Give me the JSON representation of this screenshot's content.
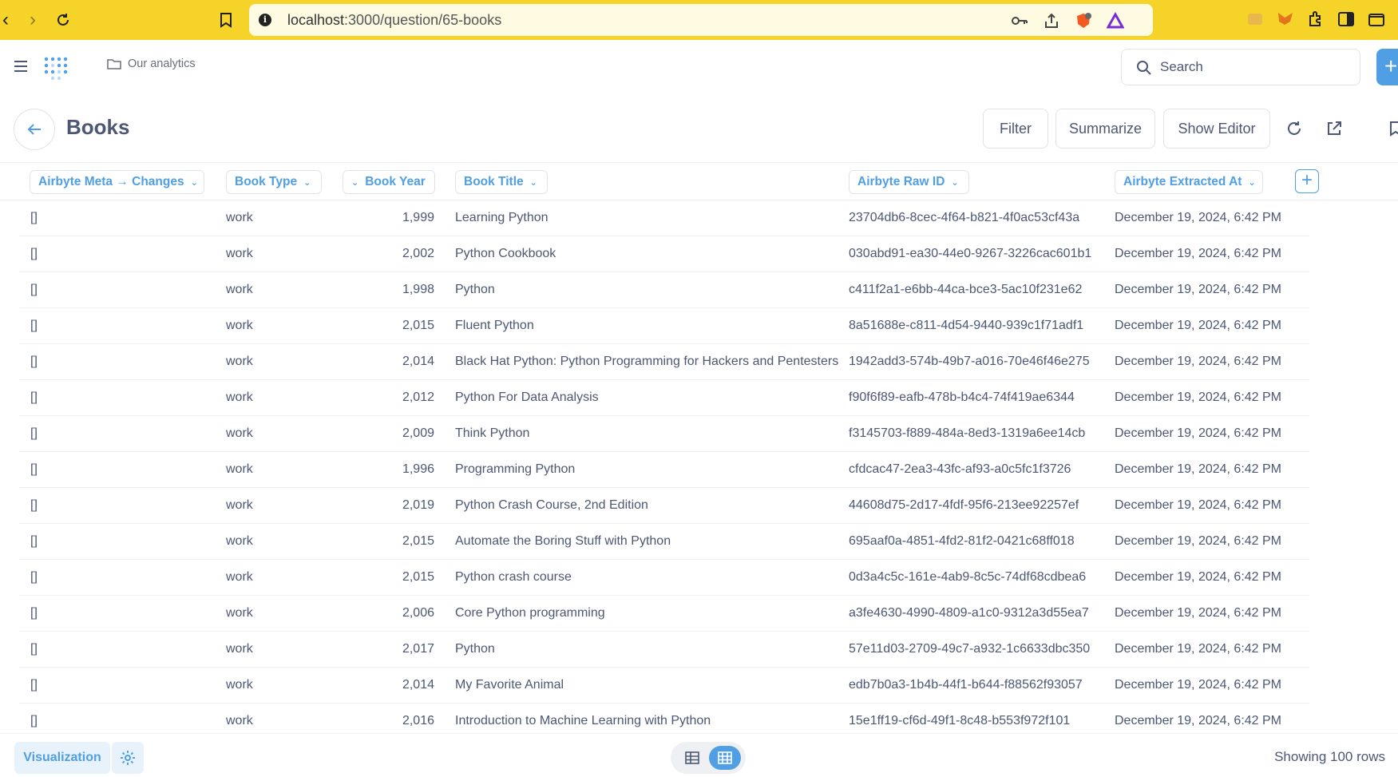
{
  "browser": {
    "url_host": "localhost",
    "url_path": ":3000/question/65-books"
  },
  "header": {
    "breadcrumb": "Our analytics",
    "search_placeholder": "Search",
    "new_label": "+"
  },
  "title_row": {
    "title": "Books",
    "filter_label": "Filter",
    "summarize_label": "Summarize",
    "show_editor_label": "Show Editor"
  },
  "columns": [
    {
      "label": "Airbyte Meta → Changes"
    },
    {
      "label": "Book Type"
    },
    {
      "label": "Book Year"
    },
    {
      "label": "Book Title"
    },
    {
      "label": "Airbyte Raw ID"
    },
    {
      "label": "Airbyte Extracted At"
    }
  ],
  "rows": [
    {
      "meta": "[]",
      "type": "work",
      "year": "1,999",
      "title": "Learning Python",
      "raw_id": "23704db6-8cec-4f64-b821-4f0ac53cf43a",
      "extracted": "December 19, 2024, 6:42 PM"
    },
    {
      "meta": "[]",
      "type": "work",
      "year": "2,002",
      "title": "Python Cookbook",
      "raw_id": "030abd91-ea30-44e0-9267-3226cac601b1",
      "extracted": "December 19, 2024, 6:42 PM"
    },
    {
      "meta": "[]",
      "type": "work",
      "year": "1,998",
      "title": "Python",
      "raw_id": "c411f2a1-e6bb-44ca-bce3-5ac10f231e62",
      "extracted": "December 19, 2024, 6:42 PM"
    },
    {
      "meta": "[]",
      "type": "work",
      "year": "2,015",
      "title": "Fluent Python",
      "raw_id": "8a51688e-c811-4d54-9440-939c1f71adf1",
      "extracted": "December 19, 2024, 6:42 PM"
    },
    {
      "meta": "[]",
      "type": "work",
      "year": "2,014",
      "title": "Black Hat Python: Python Programming for Hackers and Pentesters",
      "raw_id": "1942add3-574b-49b7-a016-70e46f46e275",
      "extracted": "December 19, 2024, 6:42 PM"
    },
    {
      "meta": "[]",
      "type": "work",
      "year": "2,012",
      "title": "Python For Data Analysis",
      "raw_id": "f90f6f89-eafb-478b-b4c4-74f419ae6344",
      "extracted": "December 19, 2024, 6:42 PM"
    },
    {
      "meta": "[]",
      "type": "work",
      "year": "2,009",
      "title": "Think Python",
      "raw_id": "f3145703-f889-484a-8ed3-1319a6ee14cb",
      "extracted": "December 19, 2024, 6:42 PM"
    },
    {
      "meta": "[]",
      "type": "work",
      "year": "1,996",
      "title": "Programming Python",
      "raw_id": "cfdcac47-2ea3-43fc-af93-a0c5fc1f3726",
      "extracted": "December 19, 2024, 6:42 PM"
    },
    {
      "meta": "[]",
      "type": "work",
      "year": "2,019",
      "title": "Python Crash Course, 2nd Edition",
      "raw_id": "44608d75-2d17-4fdf-95f6-213ee92257ef",
      "extracted": "December 19, 2024, 6:42 PM"
    },
    {
      "meta": "[]",
      "type": "work",
      "year": "2,015",
      "title": "Automate the Boring Stuff with Python",
      "raw_id": "695aaf0a-4851-4fd2-81f2-0421c68ff018",
      "extracted": "December 19, 2024, 6:42 PM"
    },
    {
      "meta": "[]",
      "type": "work",
      "year": "2,015",
      "title": "Python crash course",
      "raw_id": "0d3a4c5c-161e-4ab9-8c5c-74df68cdbea6",
      "extracted": "December 19, 2024, 6:42 PM"
    },
    {
      "meta": "[]",
      "type": "work",
      "year": "2,006",
      "title": "Core Python programming",
      "raw_id": "a3fe4630-4990-4809-a1c0-9312a3d55ea7",
      "extracted": "December 19, 2024, 6:42 PM"
    },
    {
      "meta": "[]",
      "type": "work",
      "year": "2,017",
      "title": "Python",
      "raw_id": "57e11d03-2709-49c7-a932-1c6633dbc350",
      "extracted": "December 19, 2024, 6:42 PM"
    },
    {
      "meta": "[]",
      "type": "work",
      "year": "2,014",
      "title": "My Favorite Animal",
      "raw_id": "edb7b0a3-1b4b-44f1-b644-f88562f93057",
      "extracted": "December 19, 2024, 6:42 PM"
    },
    {
      "meta": "[]",
      "type": "work",
      "year": "2,016",
      "title": "Introduction to Machine Learning with Python",
      "raw_id": "15e1ff19-cf6d-49f1-8c48-b553f972f101",
      "extracted": "December 19, 2024, 6:42 PM"
    }
  ],
  "footer": {
    "visualization_label": "Visualization",
    "row_count": "Showing 100 rows"
  },
  "colors": {
    "browser_bar": "#f5d328",
    "brand_blue": "#509ee3",
    "text": "#4c5773"
  }
}
